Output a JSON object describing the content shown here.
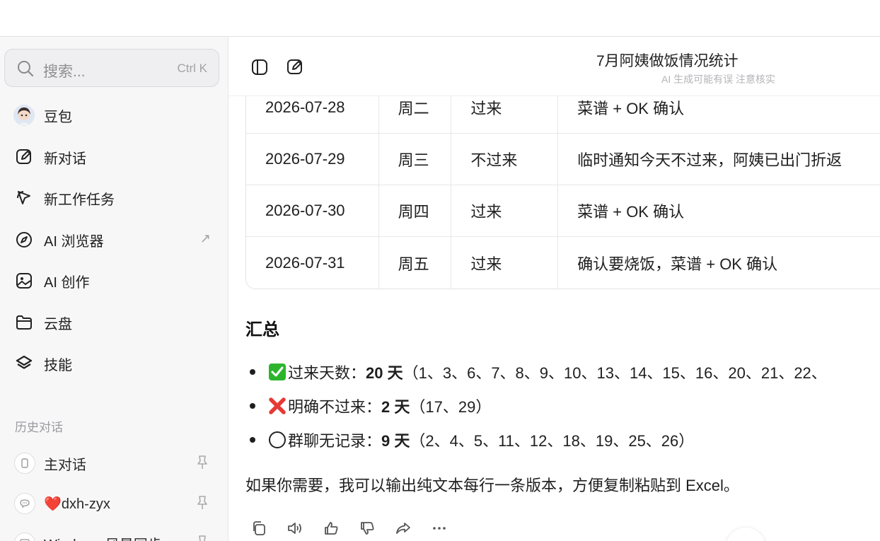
{
  "sidebar": {
    "search_placeholder": "搜索...",
    "search_shortcut": "Ctrl K",
    "nav": [
      {
        "label": "豆包",
        "icon": "avatar-icon"
      },
      {
        "label": "新对话",
        "icon": "edit-icon"
      },
      {
        "label": "新工作任务",
        "icon": "cursor-icon"
      },
      {
        "label": "AI 浏览器",
        "icon": "compass-icon",
        "arrow": "↗"
      },
      {
        "label": "AI 创作",
        "icon": "image-icon"
      },
      {
        "label": "云盘",
        "icon": "folder-icon"
      },
      {
        "label": "技能",
        "icon": "layers-icon"
      }
    ],
    "history_title": "历史对话",
    "history": [
      {
        "label": "主对话",
        "prefix": ""
      },
      {
        "label": "dxh-zyx",
        "prefix": "❤️"
      },
      {
        "label": "Windows 风景同步",
        "prefix": ""
      }
    ]
  },
  "header": {
    "title": "7月阿姨做饭情况统计",
    "subtitle": "AI 生成可能有误 注意核实"
  },
  "table": {
    "rows": [
      [
        "2026-07-28",
        "周二",
        "过来",
        "菜谱 + OK 确认"
      ],
      [
        "2026-07-29",
        "周三",
        "不过来",
        "临时通知今天不过来，阿姨已出门折返"
      ],
      [
        "2026-07-30",
        "周四",
        "过来",
        "菜谱 + OK 确认"
      ],
      [
        "2026-07-31",
        "周五",
        "过来",
        "确认要烧饭，菜谱 + OK 确认"
      ]
    ]
  },
  "summary": {
    "heading": "汇总",
    "items": [
      {
        "label": "过来天数：",
        "value": "20 天",
        "detail": "（1、3、6、7、8、9、10、13、14、15、16、20、21、22、",
        "emoji": "check"
      },
      {
        "label": "明确不过来：",
        "value": "2 天",
        "detail": "（17、29）",
        "emoji": "cross"
      },
      {
        "label": "群聊无记录：",
        "value": "9 天",
        "detail": "（2、4、5、11、12、18、19、25、26）",
        "emoji": "circle"
      }
    ],
    "footer": "如果你需要，我可以输出纯文本每行一条版本，方便复制粘贴到 Excel。"
  }
}
